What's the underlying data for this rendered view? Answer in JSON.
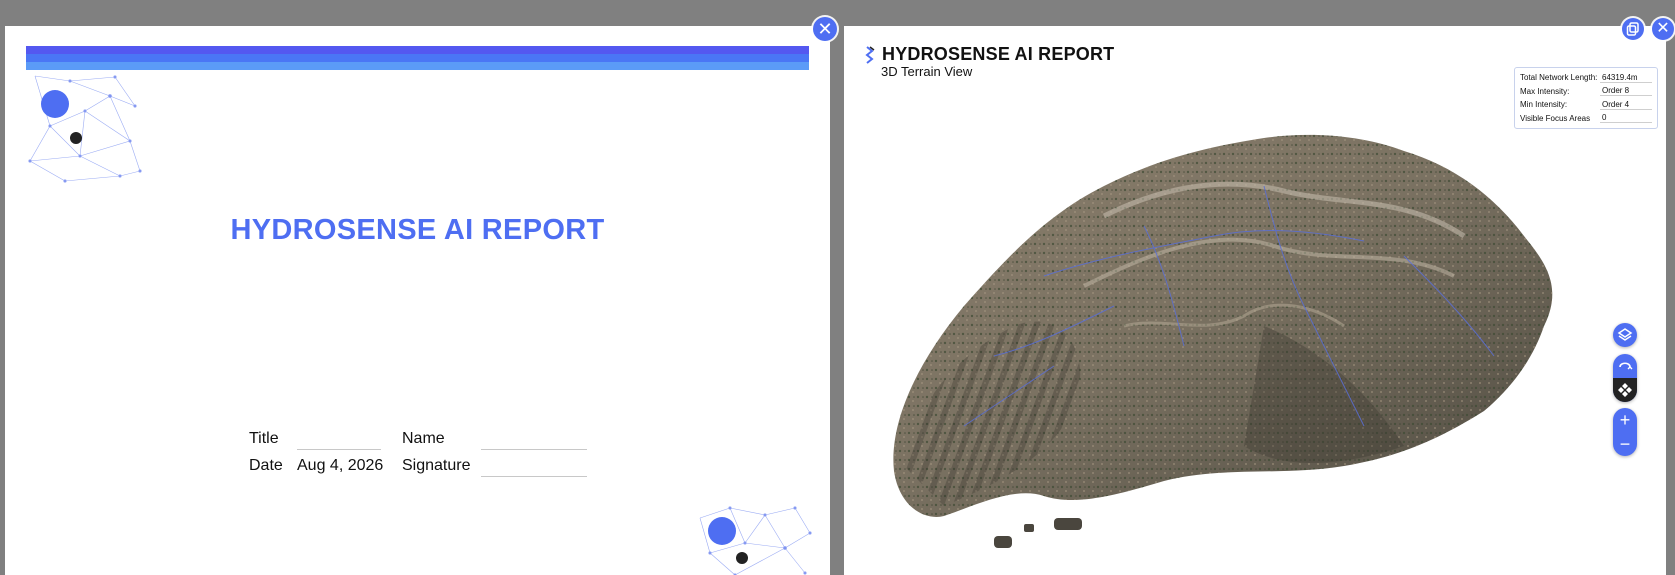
{
  "colors": {
    "accent": "#4e6ef2",
    "banner_top": "#5458f0",
    "banner_mid": "#4a76f5",
    "banner_bottom": "#5b9bf7",
    "page_bg": "#ffffff",
    "backdrop": "#808080",
    "dot_dark": "#222222"
  },
  "cover": {
    "title": "HYDROSENSE AI REPORT",
    "fields": {
      "title_label": "Title",
      "title_value": "",
      "name_label": "Name",
      "name_value": "",
      "date_label": "Date",
      "date_value": "Aug 4, 2026",
      "signature_label": "Signature",
      "signature_value": ""
    },
    "close_icon": "close-icon"
  },
  "terrain_page": {
    "brand": "HYDROSENSE AI REPORT",
    "subtitle": "3D Terrain View",
    "stats": [
      {
        "label": "Total Network Length:",
        "value": "64319.4m"
      },
      {
        "label": "Max Intensity:",
        "value": "Order 8"
      },
      {
        "label": "Min Intensity:",
        "value": "Order 4"
      },
      {
        "label": "Visible Focus Areas",
        "value": "0"
      }
    ],
    "controls": {
      "layers_icon": "layers-icon",
      "rotate_icon": "rotate-icon",
      "pan_icon": "pan-icon",
      "zoom_in_icon": "plus-icon",
      "zoom_out_icon": "minus-icon",
      "copy_icon": "copy-icon",
      "close_icon": "close-icon"
    }
  }
}
